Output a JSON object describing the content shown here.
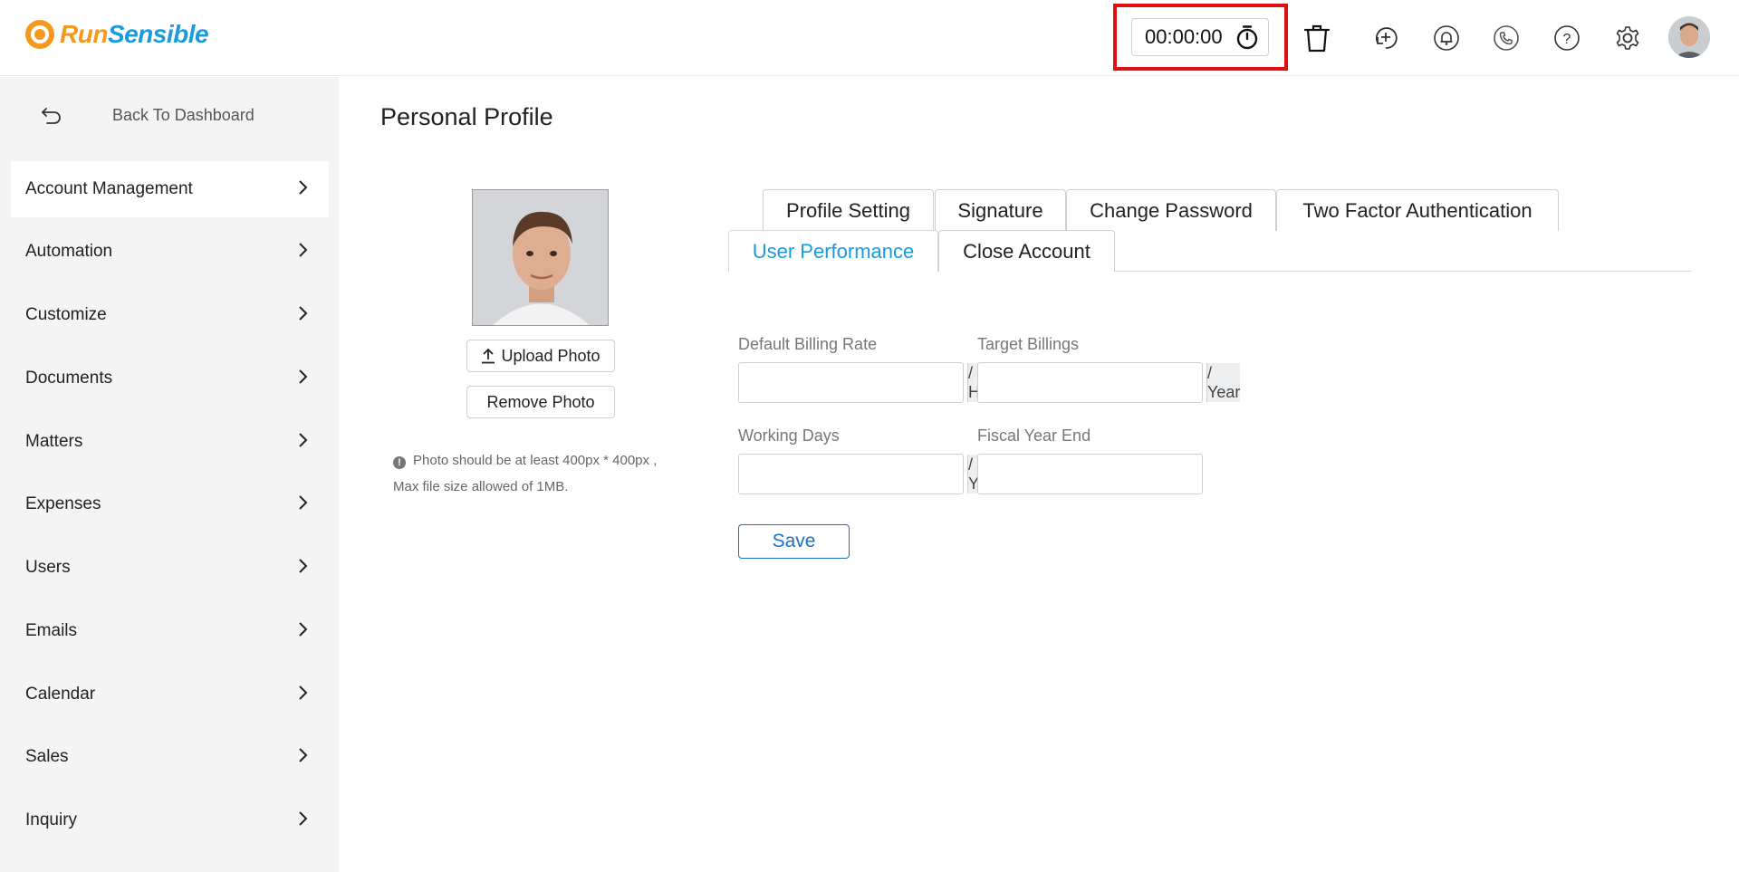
{
  "header": {
    "logo_run": "Run",
    "logo_sensible": "Sensible",
    "timer": "00:00:00",
    "icons": [
      "stopwatch-icon",
      "trash-icon",
      "add-time-icon",
      "bell-icon",
      "phone-icon",
      "help-icon",
      "gear-icon",
      "avatar"
    ]
  },
  "sidebar": {
    "back_label": "Back To Dashboard",
    "items": [
      {
        "label": "Account Management"
      },
      {
        "label": "Automation"
      },
      {
        "label": "Customize"
      },
      {
        "label": "Documents"
      },
      {
        "label": "Matters"
      },
      {
        "label": "Expenses"
      },
      {
        "label": "Users"
      },
      {
        "label": "Emails"
      },
      {
        "label": "Calendar"
      },
      {
        "label": "Sales"
      },
      {
        "label": "Inquiry"
      }
    ]
  },
  "main": {
    "title": "Personal Profile",
    "upload_photo": "Upload Photo",
    "remove_photo": "Remove Photo",
    "photo_note_line1": "Photo should be at least 400px * 400px ,",
    "photo_note_line2": "Max file size allowed of 1MB.",
    "tabs": [
      {
        "label": "Profile Setting"
      },
      {
        "label": "Signature"
      },
      {
        "label": "Change Password"
      },
      {
        "label": "Two Factor Authentication"
      },
      {
        "label": "User Performance"
      },
      {
        "label": "Close Account"
      }
    ],
    "form": {
      "default_billing_rate_label": "Default Billing Rate",
      "default_billing_rate_value": "",
      "default_billing_rate_addon": "/ Hr",
      "target_billings_label": "Target Billings",
      "target_billings_value": "",
      "target_billings_addon": "/ Year",
      "working_days_label": "Working Days",
      "working_days_value": "",
      "working_days_addon": "/ Year",
      "fiscal_year_end_label": "Fiscal Year End",
      "fiscal_year_end_value": "",
      "save_label": "Save"
    }
  },
  "colors": {
    "brand_orange": "#f39a1e",
    "brand_blue": "#1a9be0",
    "highlight_red": "#e01010",
    "save_blue": "#1a73c8"
  }
}
